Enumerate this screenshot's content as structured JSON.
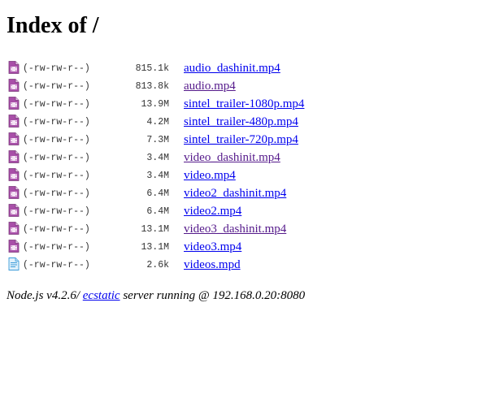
{
  "page": {
    "title": "Index of /"
  },
  "colors": {
    "link": "#0000ee",
    "visited_link": "#551a8b",
    "video_icon": "#a84fa8",
    "doc_icon": "#3b9bd9"
  },
  "files": [
    {
      "perms": "(-rw-rw-r--)",
      "size": "815.1k",
      "name": "audio_dashinit.mp4",
      "icon": "video-file-icon",
      "visited": false
    },
    {
      "perms": "(-rw-rw-r--)",
      "size": "813.8k",
      "name": "audio.mp4",
      "icon": "video-file-icon",
      "visited": true
    },
    {
      "perms": "(-rw-rw-r--)",
      "size": "13.9M",
      "name": "sintel_trailer-1080p.mp4",
      "icon": "video-file-icon",
      "visited": false
    },
    {
      "perms": "(-rw-rw-r--)",
      "size": "4.2M",
      "name": "sintel_trailer-480p.mp4",
      "icon": "video-file-icon",
      "visited": false
    },
    {
      "perms": "(-rw-rw-r--)",
      "size": "7.3M",
      "name": "sintel_trailer-720p.mp4",
      "icon": "video-file-icon",
      "visited": false
    },
    {
      "perms": "(-rw-rw-r--)",
      "size": "3.4M",
      "name": "video_dashinit.mp4",
      "icon": "video-file-icon",
      "visited": true
    },
    {
      "perms": "(-rw-rw-r--)",
      "size": "3.4M",
      "name": "video.mp4",
      "icon": "video-file-icon",
      "visited": false
    },
    {
      "perms": "(-rw-rw-r--)",
      "size": "6.4M",
      "name": "video2_dashinit.mp4",
      "icon": "video-file-icon",
      "visited": false
    },
    {
      "perms": "(-rw-rw-r--)",
      "size": "6.4M",
      "name": "video2.mp4",
      "icon": "video-file-icon",
      "visited": false
    },
    {
      "perms": "(-rw-rw-r--)",
      "size": "13.1M",
      "name": "video3_dashinit.mp4",
      "icon": "video-file-icon",
      "visited": true
    },
    {
      "perms": "(-rw-rw-r--)",
      "size": "13.1M",
      "name": "video3.mp4",
      "icon": "video-file-icon",
      "visited": false
    },
    {
      "perms": "(-rw-rw-r--)",
      "size": "2.6k",
      "name": "videos.mpd",
      "icon": "document-file-icon",
      "visited": false
    }
  ],
  "footer": {
    "prefix": "Node.js v4.2.6/ ",
    "link_text": "ecstatic",
    "suffix": " server running @ 192.168.0.20:8080"
  }
}
